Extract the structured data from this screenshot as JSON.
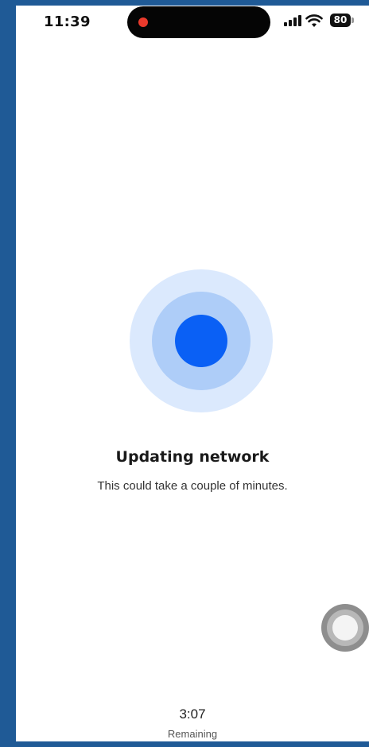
{
  "status_bar": {
    "time": "11:39",
    "battery": "80",
    "recording_indicator_color": "#ea3a2c",
    "icons": [
      "signal-icon",
      "wifi-icon",
      "battery-icon"
    ]
  },
  "progress": {
    "title": "Updating network",
    "subtitle": "This could take a couple of minutes.",
    "accent_color": "#0a60f5"
  },
  "timer": {
    "value": "3:07",
    "label": "Remaining"
  },
  "assistive_touch": {
    "icon": "assistive-touch-icon"
  }
}
